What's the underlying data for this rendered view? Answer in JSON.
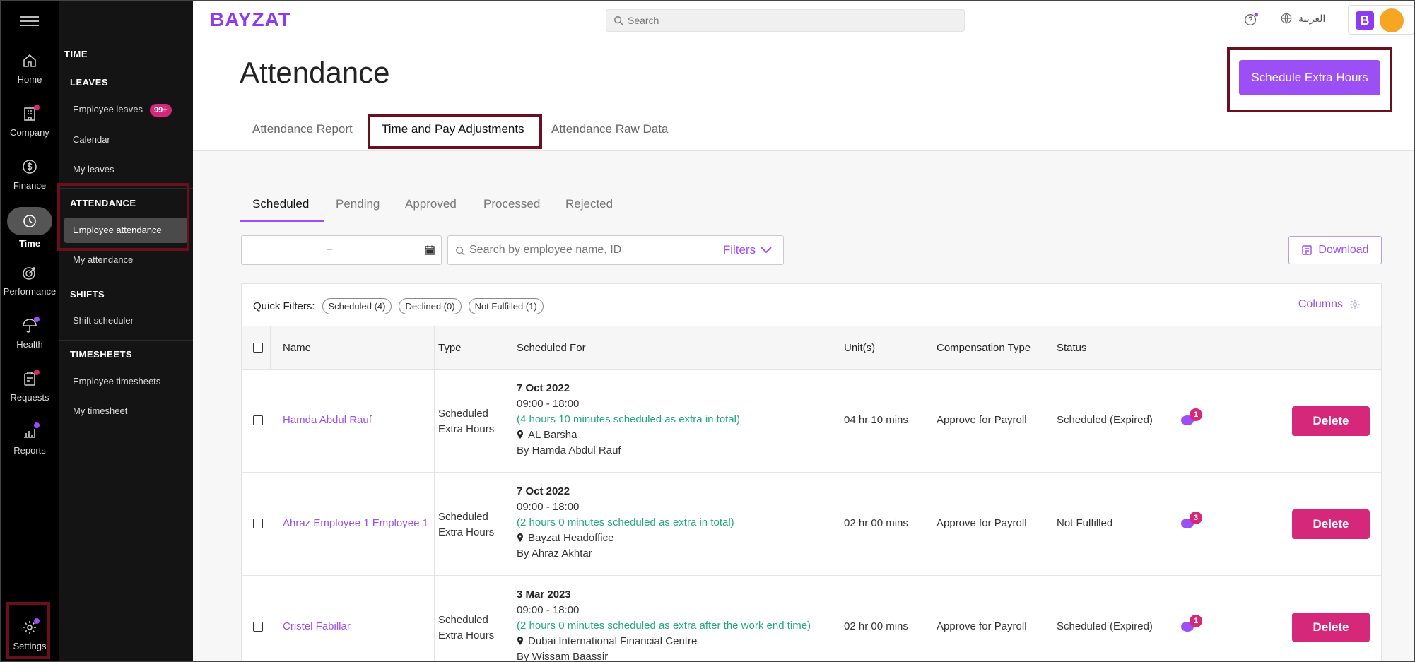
{
  "rail": {
    "items": [
      {
        "label": "Home",
        "icon": "home-icon"
      },
      {
        "label": "Company",
        "icon": "building-icon",
        "dot": "#d6287a"
      },
      {
        "label": "Finance",
        "icon": "dollar-icon"
      },
      {
        "label": "Time",
        "icon": "clock-icon"
      },
      {
        "label": "Performance",
        "icon": "target-icon"
      },
      {
        "label": "Health",
        "icon": "umbrella-icon",
        "dot": "#9b4ff5"
      },
      {
        "label": "Requests",
        "icon": "clipboard-icon",
        "dot": "#d6287a"
      },
      {
        "label": "Reports",
        "icon": "chart-icon",
        "dot": "#9b4ff5"
      },
      {
        "label": "Settings",
        "icon": "gear-icon",
        "dot": "#9b4ff5"
      }
    ]
  },
  "sidebar": {
    "title": "TIME",
    "leaves": {
      "heading": "LEAVES",
      "items": [
        "Employee leaves",
        "Calendar",
        "My leaves"
      ],
      "badge": "99+"
    },
    "attendance": {
      "heading": "ATTENDANCE",
      "items": [
        "Employee attendance",
        "My attendance"
      ]
    },
    "shifts": {
      "heading": "SHIFTS",
      "items": [
        "Shift scheduler"
      ]
    },
    "timesheets": {
      "heading": "TIMESHEETS",
      "items": [
        "Employee timesheets",
        "My timesheet"
      ]
    }
  },
  "topbar": {
    "logo": "BAYZAT",
    "search_placeholder": "Search",
    "language": "العربية",
    "account_initial": "B"
  },
  "page": {
    "title": "Attendance",
    "primary_button": "Schedule Extra Hours",
    "tabs": [
      "Attendance Report",
      "Time and Pay Adjustments",
      "Attendance Raw Data"
    ],
    "subtabs": [
      "Scheduled",
      "Pending",
      "Approved",
      "Processed",
      "Rejected"
    ],
    "date_separator": "–",
    "employee_search_placeholder": "Search by employee name, ID",
    "filters_label": "Filters",
    "download_label": "Download",
    "quick_filters_label": "Quick Filters:",
    "quick_filters": [
      "Scheduled (4)",
      "Declined (0)",
      "Not Fulfilled (1)"
    ],
    "columns_label": "Columns"
  },
  "table": {
    "headers": [
      "Name",
      "Type",
      "Scheduled For",
      "Unit(s)",
      "Compensation Type",
      "Status"
    ],
    "rows": [
      {
        "name": "Hamda Abdul Rauf",
        "type1": "Scheduled",
        "type2": "Extra Hours",
        "date": "7 Oct 2022",
        "time": "09:00 - 18:00",
        "note": "(4 hours 10 minutes scheduled as extra in total)",
        "location": "AL Barsha",
        "by": "By Hamda Abdul Rauf",
        "units": "04 hr 10 mins",
        "comp": "Approve for Payroll",
        "status": "Scheduled (Expired)",
        "comments": "1",
        "action": "Delete"
      },
      {
        "name": "Ahraz Employee 1 Employee 1",
        "type1": "Scheduled",
        "type2": "Extra Hours",
        "date": "7 Oct 2022",
        "time": "09:00 - 18:00",
        "note": "(2 hours 0 minutes scheduled as extra in total)",
        "location": "Bayzat Headoffice",
        "by": "By Ahraz Akhtar",
        "units": "02 hr 00 mins",
        "comp": "Approve for Payroll",
        "status": "Not Fulfilled",
        "comments": "3",
        "action": "Delete"
      },
      {
        "name": "Cristel Fabillar",
        "type1": "Scheduled",
        "type2": "Extra Hours",
        "date": "3 Mar 2023",
        "time": "09:00 - 18:00",
        "note": "(2 hours 0 minutes scheduled as extra after the work end time)",
        "location": "Dubai International Financial Centre",
        "by": "By Wissam Baassir",
        "units": "02 hr 00 mins",
        "comp": "Approve for Payroll",
        "status": "Scheduled (Expired)",
        "comments": "1",
        "action": "Delete"
      }
    ]
  }
}
